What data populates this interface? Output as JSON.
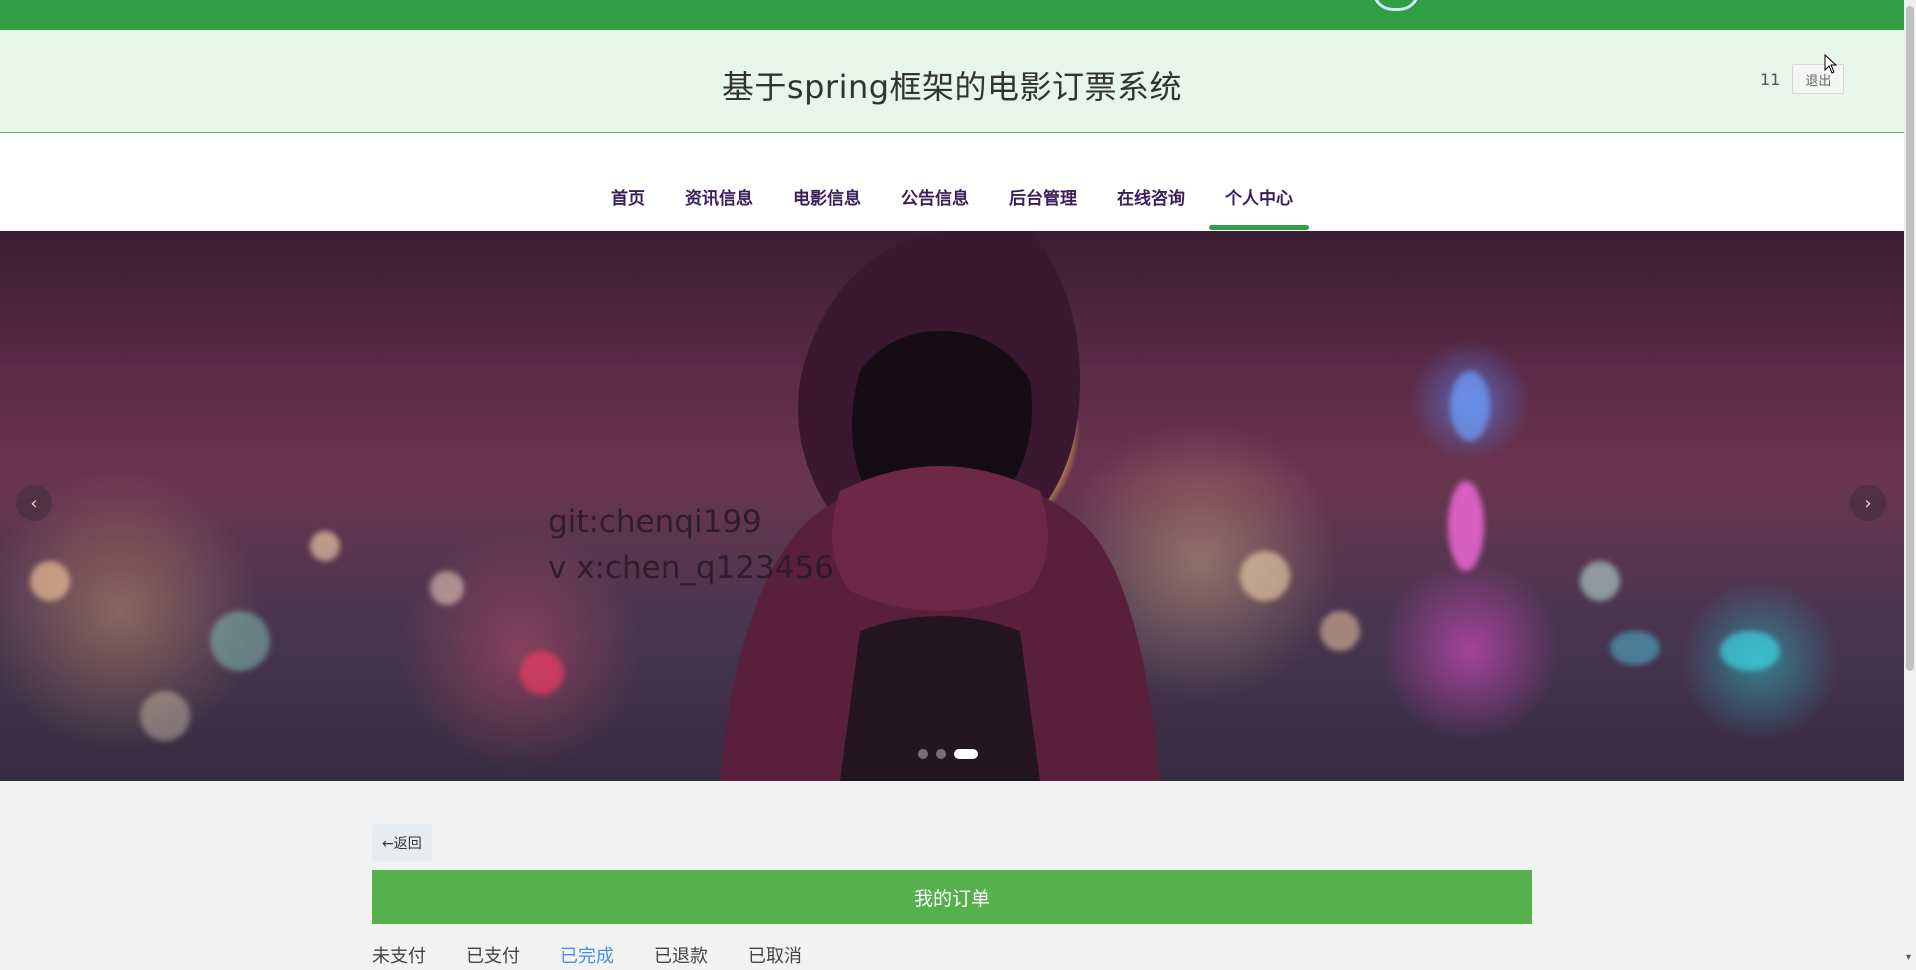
{
  "header": {
    "title": "基于spring框架的电影订票系统",
    "username": "11",
    "logout_label": "退出"
  },
  "nav": {
    "items": [
      {
        "label": "首页"
      },
      {
        "label": "资讯信息"
      },
      {
        "label": "电影信息"
      },
      {
        "label": "公告信息"
      },
      {
        "label": "后台管理"
      },
      {
        "label": "在线咨询"
      },
      {
        "label": "个人中心"
      }
    ],
    "active": "个人中心"
  },
  "banner": {
    "watermark_line1": "git:chenqi199",
    "watermark_line2": "v x:chen_q123456",
    "prev_icon": "‹",
    "next_icon": "›",
    "slide_count": 3,
    "active_slide": 3
  },
  "content": {
    "back_label": "←返回",
    "order_title": "我的订单",
    "status_tabs": [
      {
        "label": "未支付"
      },
      {
        "label": "已支付"
      },
      {
        "label": "已完成"
      },
      {
        "label": "已退款"
      },
      {
        "label": "已取消"
      }
    ],
    "active_tab": "已完成"
  },
  "colors": {
    "brand_green": "#2f9e44",
    "header_bg": "#e8f5ea",
    "order_bar": "#55b04d",
    "active_tab": "#4a90e2",
    "nav_text": "#3b1f5b"
  }
}
